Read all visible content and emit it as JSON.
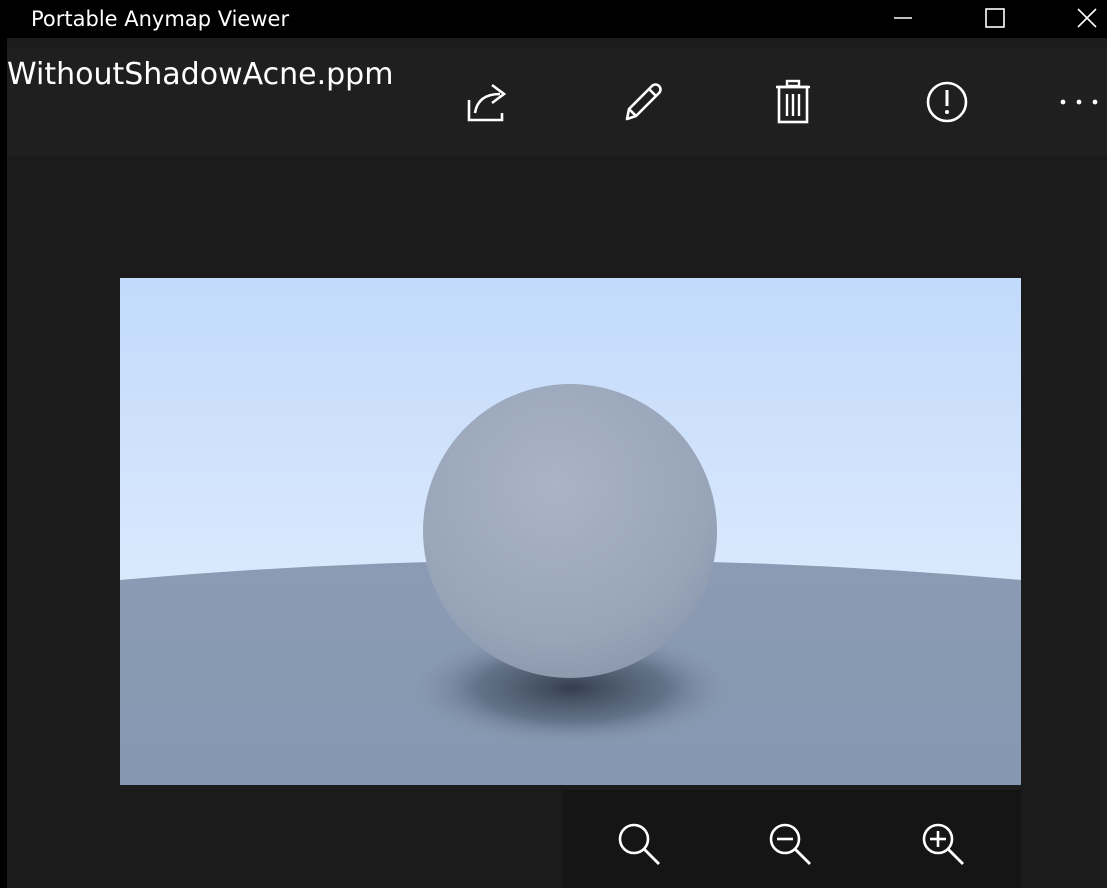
{
  "window": {
    "title": "Portable Anymap Viewer",
    "caption_icons": [
      "minimize-icon",
      "maximize-icon",
      "close-icon"
    ]
  },
  "commandbar": {
    "file_name": "WithoutShadowAcne.ppm",
    "icons": [
      "share-icon",
      "pencil-icon",
      "trash-icon",
      "info-icon",
      "more-icon"
    ]
  },
  "image": {
    "scene": "rendered sphere on ground plane under sky gradient",
    "colors": {
      "sky_top": "#c2dafb",
      "sky_bottom": "#eaf2fd",
      "ground": "#8b9cb4",
      "sphere": "#9aa6b9"
    }
  },
  "zoombar": {
    "icons": [
      "zoom-fit-icon",
      "zoom-out-icon",
      "zoom-in-icon"
    ]
  },
  "colors": {
    "titlebar_bg": "#000000",
    "commandbar_bg": "#1f1f1f",
    "canvas_bg": "#1b1b1b",
    "zoombar_bg": "#151515",
    "foreground": "#ffffff"
  }
}
